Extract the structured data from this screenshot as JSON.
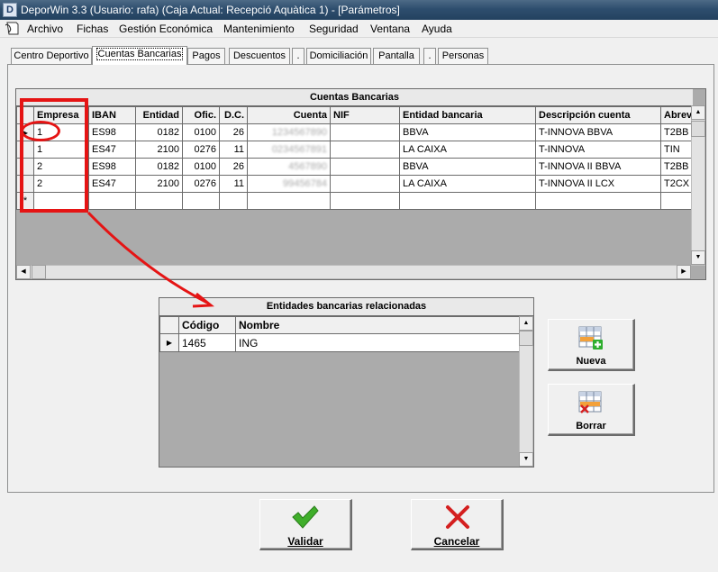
{
  "window": {
    "app_icon_letter": "D",
    "title": "DeporWin 3.3  (Usuario: rafa)  (Caja Actual: Recepció Aquàtica 1) - [Parámetros]"
  },
  "menu": [
    "Archivo",
    "Fichas",
    "Gestión Económica",
    "Mantenimiento",
    "Seguridad",
    "Ventana",
    "Ayuda"
  ],
  "tabs": [
    {
      "label": "Centro Deportivo",
      "active": false
    },
    {
      "label": "Cuentas Bancarias",
      "active": true
    },
    {
      "label": "Pagos",
      "active": false
    },
    {
      "label": "Descuentos",
      "active": false
    },
    {
      "label": ".",
      "active": false
    },
    {
      "label": "Domiciliación",
      "active": false
    },
    {
      "label": "Pantalla",
      "active": false
    },
    {
      "label": ".",
      "active": false
    },
    {
      "label": "Personas",
      "active": false
    }
  ],
  "accounts_grid": {
    "caption": "Cuentas Bancarias",
    "columns": [
      "Empresa",
      "IBAN",
      "Entidad",
      "Ofic.",
      "D.C.",
      "Cuenta",
      "NIF",
      "Entidad bancaria",
      "Descripción cuenta",
      "Abrev"
    ],
    "rows": [
      {
        "empresa": "1",
        "iban": "ES98",
        "entidad": "0182",
        "ofic": "0100",
        "dc": "26",
        "cuenta": "1234567890",
        "nif": "",
        "entidad_bancaria": "BBVA",
        "descripcion": "T-INNOVA BBVA",
        "abrev": "T2BB",
        "current": true
      },
      {
        "empresa": "1",
        "iban": "ES47",
        "entidad": "2100",
        "ofic": "0276",
        "dc": "11",
        "cuenta": "0234567891",
        "nif": "",
        "entidad_bancaria": "LA CAIXA",
        "descripcion": "T-INNOVA",
        "abrev": "TIN",
        "current": false
      },
      {
        "empresa": "2",
        "iban": "ES98",
        "entidad": "0182",
        "ofic": "0100",
        "dc": "26",
        "cuenta": "4567890",
        "nif": "",
        "entidad_bancaria": "BBVA",
        "descripcion": "T-INNOVA II BBVA",
        "abrev": "T2BB",
        "current": false
      },
      {
        "empresa": "2",
        "iban": "ES47",
        "entidad": "2100",
        "ofic": "0276",
        "dc": "11",
        "cuenta": "99456784",
        "nif": "",
        "entidad_bancaria": "LA CAIXA",
        "descripcion": "T-INNOVA II LCX",
        "abrev": "T2CX",
        "current": false
      }
    ],
    "new_row_marker": "*"
  },
  "related_grid": {
    "caption": "Entidades bancarias relacionadas",
    "columns": [
      "Código",
      "Nombre"
    ],
    "rows": [
      {
        "codigo": "1465",
        "nombre": "ING",
        "current": true
      }
    ]
  },
  "buttons": {
    "nueva": "Nueva",
    "borrar": "Borrar",
    "validar": "Validar",
    "cancelar": "Cancelar"
  },
  "colors": {
    "annotation": "#e51414",
    "titlebar": "#2e4e6e",
    "check_green": "#3fae2a",
    "cancel_red": "#d41f1f"
  },
  "icons": [
    "arrow-right-indicator",
    "scroll-up",
    "scroll-down",
    "scroll-left",
    "scroll-right",
    "grid-add-icon",
    "grid-delete-icon",
    "checkmark-icon",
    "cross-icon"
  ]
}
